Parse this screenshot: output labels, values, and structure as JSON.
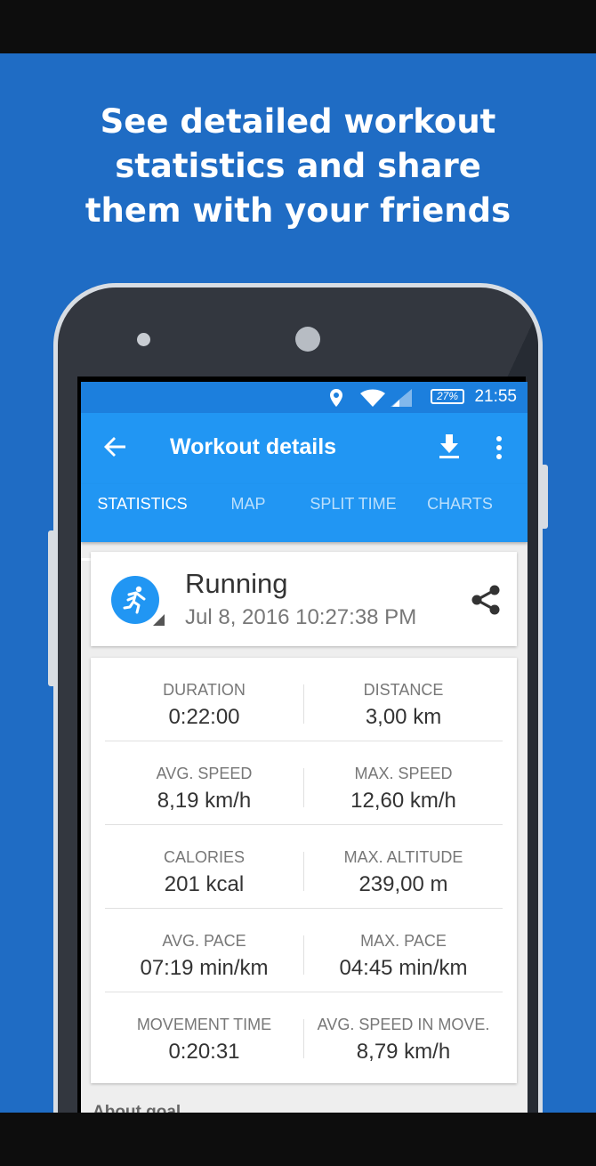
{
  "promo": {
    "headline_lines": [
      "See detailed workout",
      "statistics and share",
      "them with your friends"
    ]
  },
  "status_bar": {
    "time": "21:55",
    "battery": "27%",
    "icons": [
      "location-icon",
      "wifi-icon",
      "signal-icon",
      "battery-icon"
    ]
  },
  "app_bar": {
    "title": "Workout details",
    "icons": [
      "back-arrow-icon",
      "download-icon",
      "more-vert-icon"
    ]
  },
  "tabs": [
    {
      "label": "STATISTICS",
      "active": true
    },
    {
      "label": "MAP",
      "active": false
    },
    {
      "label": "SPLIT TIME",
      "active": false
    },
    {
      "label": "CHARTS",
      "active": false
    }
  ],
  "activity": {
    "name": "Running",
    "date": "Jul 8, 2016 10:27:38 PM",
    "icons": [
      "running-icon",
      "share-icon"
    ]
  },
  "stats": [
    [
      {
        "label": "DURATION",
        "value": "0:22:00"
      },
      {
        "label": "DISTANCE",
        "value": "3,00 km"
      }
    ],
    [
      {
        "label": "AVG. SPEED",
        "value": "8,19 km/h"
      },
      {
        "label": "MAX. SPEED",
        "value": "12,60 km/h"
      }
    ],
    [
      {
        "label": "CALORIES",
        "value": "201 kcal"
      },
      {
        "label": "MAX. ALTITUDE",
        "value": "239,00 m"
      }
    ],
    [
      {
        "label": "AVG. PACE",
        "value": "07:19 min/km"
      },
      {
        "label": "MAX. PACE",
        "value": "04:45 min/km"
      }
    ],
    [
      {
        "label": "MOVEMENT TIME",
        "value": "0:20:31"
      },
      {
        "label": "AVG. SPEED IN MOVE.",
        "value": "8,79 km/h"
      }
    ]
  ],
  "about_goal": "About goal",
  "colors": {
    "promo_bg": "#1f6cc4",
    "status_bar": "#1c7fdd",
    "app_bar": "#2196f3",
    "accent": "#2196f3"
  }
}
